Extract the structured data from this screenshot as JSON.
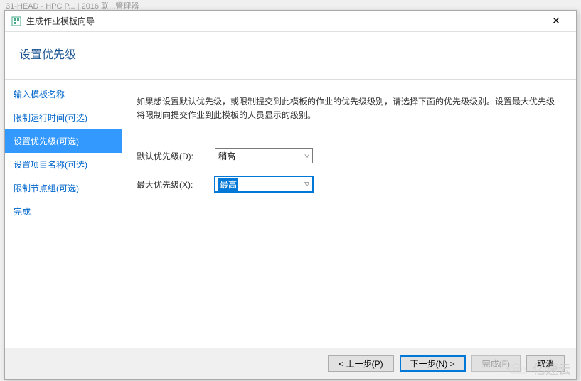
{
  "truncated_header": "31-HEAD - HPC P... | 2016 联...管理器",
  "window": {
    "title": "生成作业模板向导",
    "close_symbol": "✕"
  },
  "page_heading": "设置优先级",
  "sidebar": {
    "items": [
      {
        "label": "输入模板名称"
      },
      {
        "label": "限制运行时间(可选)"
      },
      {
        "label": "设置优先级(可选)",
        "active": true
      },
      {
        "label": "设置项目名称(可选)"
      },
      {
        "label": "限制节点组(可选)"
      },
      {
        "label": "完成"
      }
    ]
  },
  "content": {
    "description": "如果想设置默认优先级，或限制提交到此模板的作业的优先级级别，请选择下面的优先级级别。设置最大优先级将限制向提交作业到此模板的人员显示的级别。",
    "default_priority_label": "默认优先级(D):",
    "default_priority_value": "稍高",
    "max_priority_label": "最大优先级(X):",
    "max_priority_value": "最高"
  },
  "footer": {
    "prev": "< 上一步(P)",
    "next": "下一步(N) >",
    "finish": "完成(F)",
    "cancel": "取消"
  },
  "watermark": "亿速云"
}
